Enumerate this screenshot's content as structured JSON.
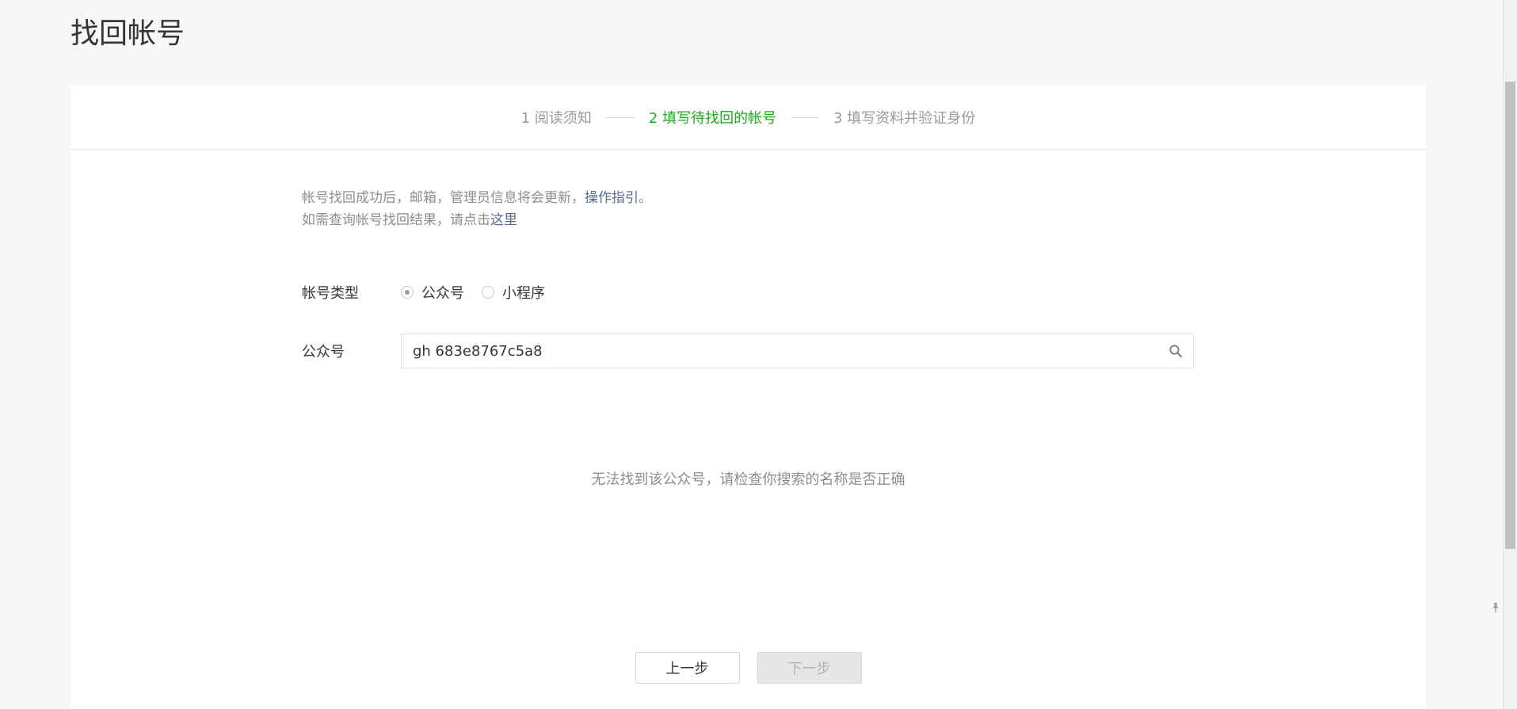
{
  "page": {
    "title": "找回帐号"
  },
  "steps": [
    {
      "label": "1 阅读须知",
      "state": "done"
    },
    {
      "label": "2 填写待找回的帐号",
      "state": "active"
    },
    {
      "label": "3 填写资料并验证身份",
      "state": "pending"
    }
  ],
  "notice": {
    "line1_text": "帐号找回成功后，邮箱，管理员信息将会更新，",
    "line1_link": "操作指引",
    "line1_end": "。",
    "line2_text": "如需查询帐号找回结果，请点击",
    "line2_link": "这里"
  },
  "form": {
    "type_label": "帐号类型",
    "options": [
      {
        "label": "公众号",
        "checked": true
      },
      {
        "label": "小程序",
        "checked": false
      }
    ],
    "account_label": "公众号",
    "account_value": "gh 683e8767c5a8"
  },
  "result": {
    "empty_tip": "无法找到该公众号，请检查你搜索的名称是否正确"
  },
  "actions": {
    "prev_label": "上一步",
    "next_label": "下一步",
    "next_disabled": true
  },
  "colors": {
    "active_step": "#1aad19",
    "link": "#576b95"
  },
  "icons": {
    "search": "search-icon",
    "pin": "pin-icon"
  }
}
